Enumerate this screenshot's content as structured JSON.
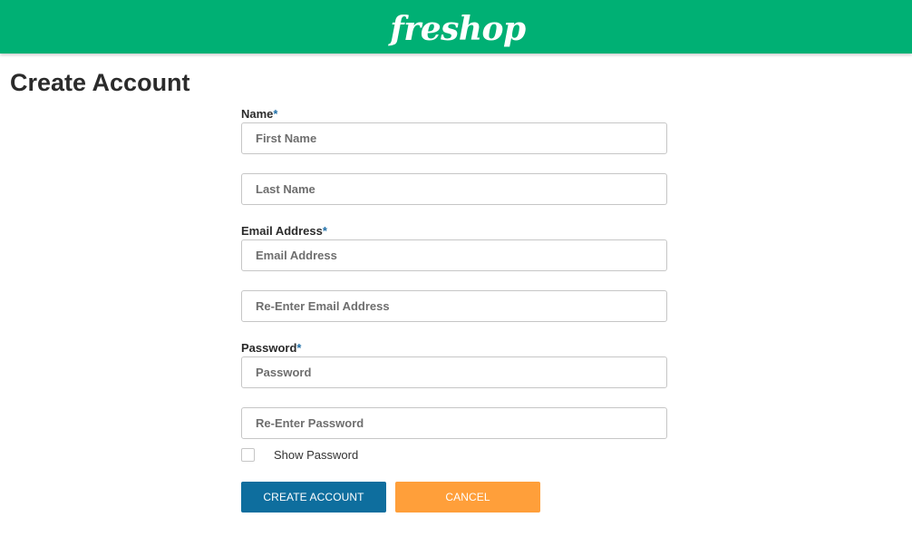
{
  "header": {
    "logo_text": "freshop",
    "background_color": "#00b074"
  },
  "page": {
    "title": "Create Account"
  },
  "form": {
    "name": {
      "label": "Name",
      "required_marker": "*",
      "first_placeholder": "First Name",
      "last_placeholder": "Last Name"
    },
    "email": {
      "label": "Email Address",
      "required_marker": "*",
      "placeholder": "Email Address",
      "confirm_placeholder": "Re-Enter Email Address"
    },
    "password": {
      "label": "Password",
      "required_marker": "*",
      "placeholder": "Password",
      "confirm_placeholder": "Re-Enter Password"
    },
    "show_password": {
      "label": "Show Password",
      "checked": false
    },
    "buttons": {
      "create_label": "CREATE ACCOUNT",
      "create_color": "#0e6e9e",
      "cancel_label": "CANCEL",
      "cancel_color": "#ff9f3a"
    }
  }
}
